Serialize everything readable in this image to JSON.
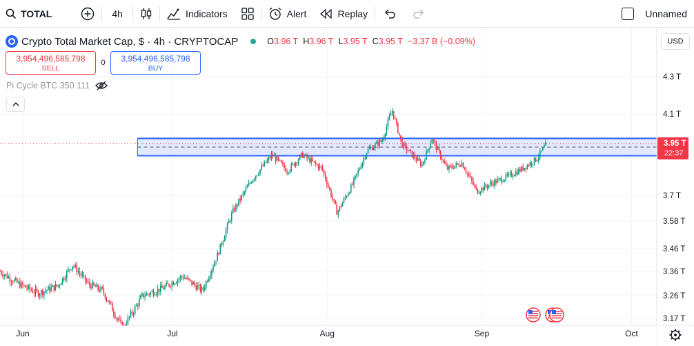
{
  "toolbar": {
    "symbol": "TOTAL",
    "interval": "4h",
    "indicators_label": "Indicators",
    "alert_label": "Alert",
    "replay_label": "Replay",
    "layout_name": "Unnamed"
  },
  "legend": {
    "title": "Crypto Total Market Cap, $ · 4h · CRYPTOCAP",
    "ohlc": [
      {
        "k": "O",
        "v": "3.96 T"
      },
      {
        "k": "H",
        "v": "3.96 T"
      },
      {
        "k": "L",
        "v": "3.95 T"
      },
      {
        "k": "C",
        "v": "3.95 T"
      },
      {
        "k": "",
        "v": "−3.37 B (−0.09%)"
      }
    ]
  },
  "trade": {
    "sell_price": "3,954,496,585,798",
    "sell_label": "SELL",
    "spread": "0",
    "buy_price": "3,954,496,585,798",
    "buy_label": "BUY"
  },
  "indicator": {
    "name": "Pi Cycle BTC 350 111"
  },
  "currency": "USD",
  "colors": {
    "up": "#089981",
    "down": "#f23645",
    "accent": "#2962ff",
    "zone_fill": "#dbe3ff"
  },
  "chart_data": {
    "type": "candlestick",
    "y_ticks": [
      {
        "label": "4.3 T",
        "value": 4.3
      },
      {
        "label": "4.1 T",
        "value": 4.1
      },
      {
        "label": "3.7 T",
        "value": 3.7
      },
      {
        "label": "3.58 T",
        "value": 3.58
      },
      {
        "label": "3.46 T",
        "value": 3.46
      },
      {
        "label": "3.36 T",
        "value": 3.36
      },
      {
        "label": "3.26 T",
        "value": 3.26
      },
      {
        "label": "3.17 T",
        "value": 3.17
      }
    ],
    "x_ticks": [
      "Jun",
      "Jul",
      "Aug",
      "Sep",
      "Oct"
    ],
    "last_price_label": "3.95 T",
    "countdown": "22:37",
    "last_price": 3.955,
    "zone": {
      "top": 3.98,
      "bottom": 3.895,
      "mid": 3.9375,
      "start": "2025-06-24",
      "end": "2025-10-15"
    },
    "series": [
      {
        "date": "2025-05-26",
        "close": 3.38
      },
      {
        "date": "2025-05-31",
        "close": 3.31
      },
      {
        "date": "2025-06-04",
        "close": 3.27
      },
      {
        "date": "2025-06-08",
        "close": 3.3
      },
      {
        "date": "2025-06-11",
        "close": 3.39
      },
      {
        "date": "2025-06-14",
        "close": 3.31
      },
      {
        "date": "2025-06-17",
        "close": 3.28
      },
      {
        "date": "2025-06-21",
        "close": 3.13
      },
      {
        "date": "2025-06-25",
        "close": 3.26
      },
      {
        "date": "2025-06-29",
        "close": 3.29
      },
      {
        "date": "2025-07-03",
        "close": 3.34
      },
      {
        "date": "2025-07-07",
        "close": 3.28
      },
      {
        "date": "2025-07-10",
        "close": 3.43
      },
      {
        "date": "2025-07-13",
        "close": 3.62
      },
      {
        "date": "2025-07-17",
        "close": 3.78
      },
      {
        "date": "2025-07-21",
        "close": 3.9
      },
      {
        "date": "2025-07-24",
        "close": 3.82
      },
      {
        "date": "2025-07-27",
        "close": 3.9
      },
      {
        "date": "2025-07-31",
        "close": 3.83
      },
      {
        "date": "2025-08-03",
        "close": 3.62
      },
      {
        "date": "2025-08-06",
        "close": 3.75
      },
      {
        "date": "2025-08-09",
        "close": 3.92
      },
      {
        "date": "2025-08-12",
        "close": 3.97
      },
      {
        "date": "2025-08-14",
        "close": 4.12
      },
      {
        "date": "2025-08-16",
        "close": 3.95
      },
      {
        "date": "2025-08-20",
        "close": 3.85
      },
      {
        "date": "2025-08-22",
        "close": 3.98
      },
      {
        "date": "2025-08-25",
        "close": 3.83
      },
      {
        "date": "2025-08-28",
        "close": 3.86
      },
      {
        "date": "2025-08-31",
        "close": 3.72
      },
      {
        "date": "2025-09-03",
        "close": 3.76
      },
      {
        "date": "2025-09-06",
        "close": 3.79
      },
      {
        "date": "2025-09-09",
        "close": 3.83
      },
      {
        "date": "2025-09-12",
        "close": 3.88
      },
      {
        "date": "2025-09-14",
        "close": 3.955
      }
    ]
  }
}
